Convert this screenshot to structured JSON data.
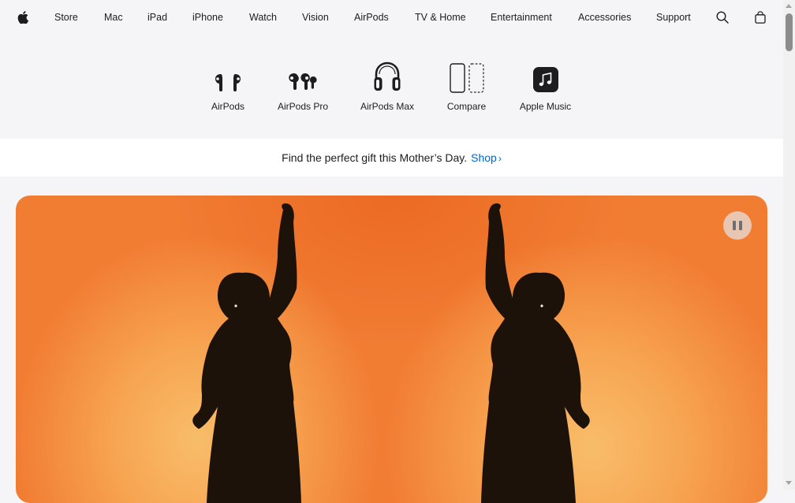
{
  "global_nav": {
    "logo_icon": "apple-logo-icon",
    "items": [
      "Store",
      "Mac",
      "iPad",
      "iPhone",
      "Watch",
      "Vision",
      "AirPods",
      "TV & Home",
      "Entertainment",
      "Accessories",
      "Support"
    ],
    "search_icon": "search-icon",
    "bag_icon": "shopping-bag-icon"
  },
  "chapter_nav": {
    "items": [
      {
        "label": "AirPods",
        "icon": "airpods-icon"
      },
      {
        "label": "AirPods Pro",
        "icon": "airpods-pro-icon"
      },
      {
        "label": "AirPods Max",
        "icon": "airpods-max-icon"
      },
      {
        "label": "Compare",
        "icon": "compare-icon"
      },
      {
        "label": "Apple Music",
        "icon": "apple-music-icon"
      }
    ]
  },
  "ribbon": {
    "text": "Find the perfect gift this Mother’s Day.",
    "link_label": "Shop",
    "link_chevron": "›",
    "link_color": "#0066cc"
  },
  "hero": {
    "background_color": "#f17d33",
    "pause_icon": "pause-icon"
  }
}
